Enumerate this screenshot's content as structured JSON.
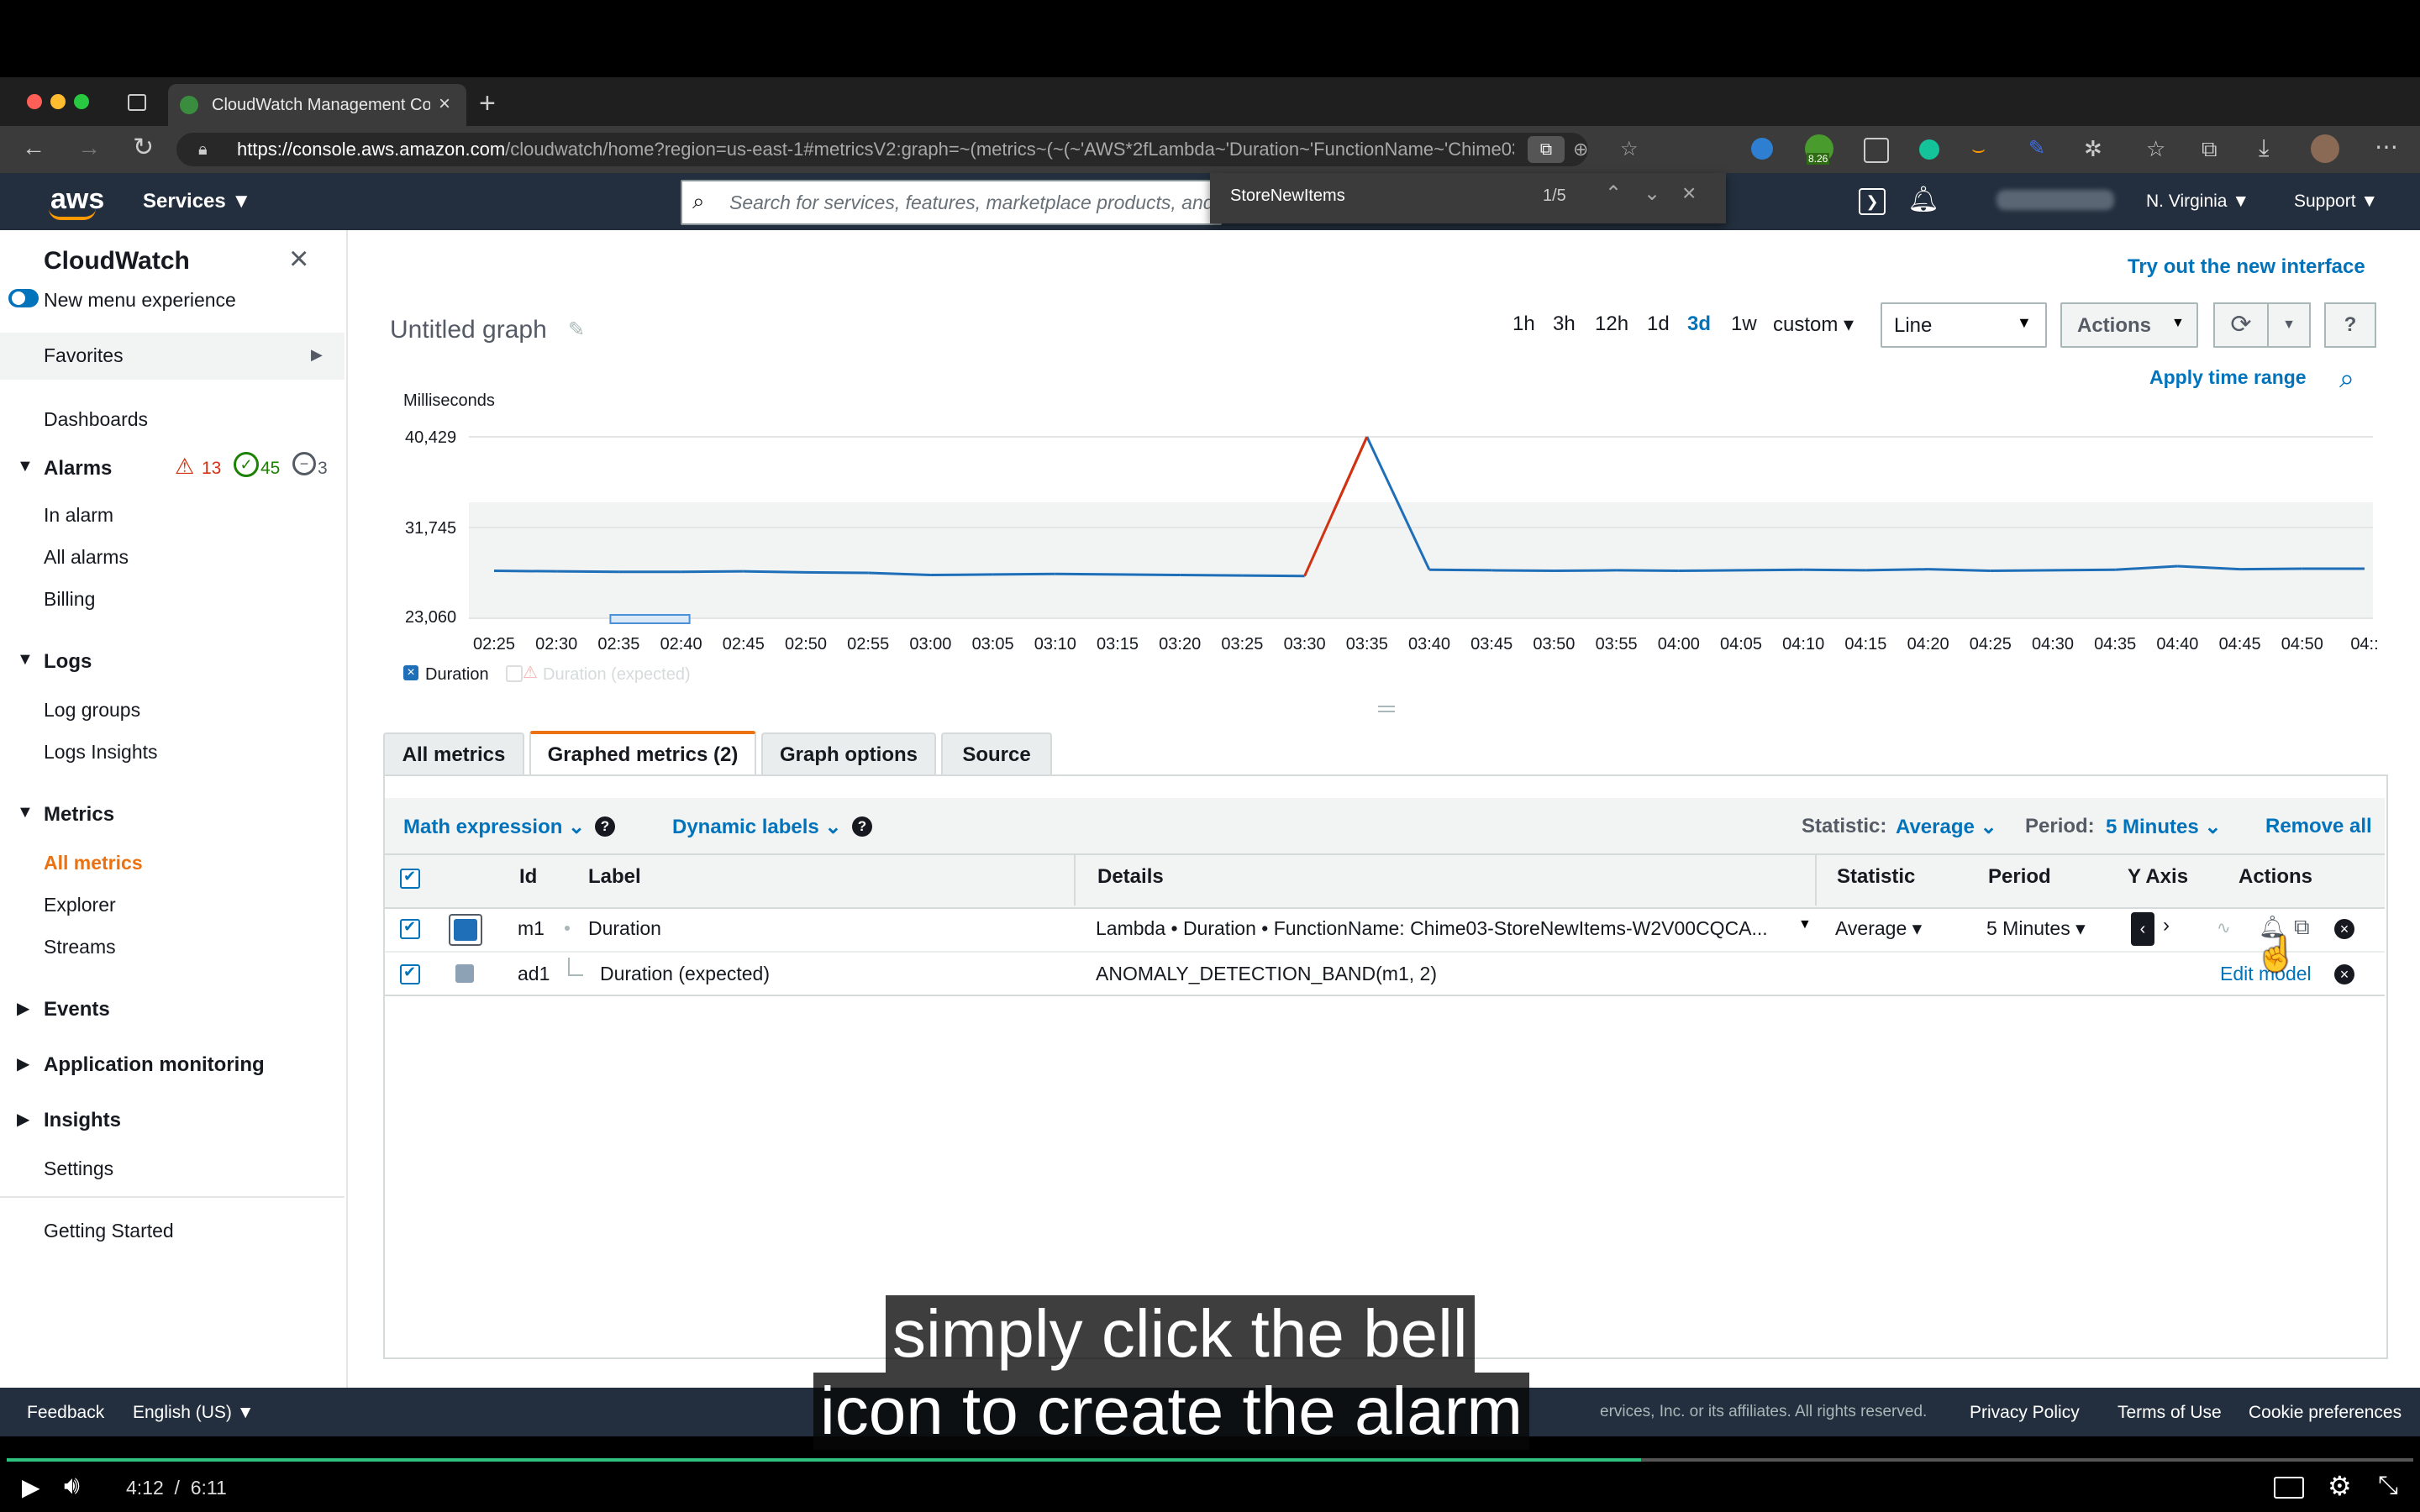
{
  "browser": {
    "tab_title": "CloudWatch Management Con",
    "url_host": "https://console.aws.amazon.com",
    "url_rest": "/cloudwatch/home?region=us-east-1#metricsV2:graph=~(metrics~(~(~'AWS*2fLambda~'Duration~'FunctionName~'Chime03-...",
    "find_query": "StoreNewItems",
    "find_count": "1/5",
    "ext_badge": "8.26"
  },
  "awsnav": {
    "logo": "aws",
    "services": "Services",
    "search_placeholder": "Search for services, features, marketplace products, and",
    "region": "N. Virginia",
    "support": "Support"
  },
  "sidebar": {
    "title": "CloudWatch",
    "new_menu": "New menu experience",
    "favorites": "Favorites",
    "dashboards": "Dashboards",
    "alarms": "Alarms",
    "alarm_count": "13",
    "ok_count": "45",
    "insufficient_count": "3",
    "in_alarm": "In alarm",
    "all_alarms": "All alarms",
    "billing": "Billing",
    "logs": "Logs",
    "log_groups": "Log groups",
    "logs_insights": "Logs Insights",
    "metrics": "Metrics",
    "all_metrics": "All metrics",
    "explorer": "Explorer",
    "streams": "Streams",
    "events": "Events",
    "app_monitoring": "Application monitoring",
    "insights": "Insights",
    "settings": "Settings",
    "getting_started": "Getting Started"
  },
  "graph": {
    "try_new": "Try out the new interface",
    "title": "Untitled graph",
    "ranges": [
      "1h",
      "3h",
      "12h",
      "1d",
      "3d",
      "1w",
      "custom"
    ],
    "active_range": "3d",
    "chart_type": "Line",
    "actions": "Actions",
    "apply_time_range": "Apply time range"
  },
  "chart_data": {
    "type": "line",
    "ylabel": "Milliseconds",
    "y_ticks": [
      "40,429",
      "31,745",
      "23,060"
    ],
    "ylim": [
      23060,
      40429
    ],
    "x": [
      "02:25",
      "02:30",
      "02:35",
      "02:40",
      "02:45",
      "02:50",
      "02:55",
      "03:00",
      "03:05",
      "03:10",
      "03:15",
      "03:20",
      "03:25",
      "03:30",
      "03:35",
      "03:40",
      "03:45",
      "03:50",
      "03:55",
      "04:00",
      "04:05",
      "04:10",
      "04:15",
      "04:20",
      "04:25",
      "04:30",
      "04:35",
      "04:40",
      "04:45",
      "04:50",
      "04::"
    ],
    "series": [
      {
        "name": "Duration",
        "values": [
          27600,
          27550,
          27500,
          27500,
          27550,
          27450,
          27400,
          27200,
          27250,
          27300,
          27250,
          27200,
          27150,
          27100,
          40429,
          27700,
          27650,
          27600,
          27650,
          27600,
          27650,
          27700,
          27650,
          27750,
          27600,
          27650,
          27700,
          28050,
          27750,
          27800,
          27800
        ]
      },
      {
        "name": "Duration (expected)",
        "values": []
      }
    ],
    "grid": true,
    "legend": "bottom-left"
  },
  "tabs": [
    "All metrics",
    "Graphed metrics (2)",
    "Graph options",
    "Source"
  ],
  "toolbar": {
    "math_expression": "Math expression",
    "dynamic_labels": "Dynamic labels",
    "statistic_label": "Statistic:",
    "statistic_value": "Average",
    "period_label": "Period:",
    "period_value": "5 Minutes",
    "remove_all": "Remove all"
  },
  "table": {
    "headers": [
      "Id",
      "Label",
      "Details",
      "Statistic",
      "Period",
      "Y Axis",
      "Actions"
    ],
    "rows": [
      {
        "id": "m1",
        "label": "Duration",
        "details": "Lambda • Duration • FunctionName: Chime03-StoreNewItems-W2V00CQCA...",
        "statistic": "Average",
        "period": "5 Minutes",
        "color": "#1f6fb8"
      },
      {
        "id": "ad1",
        "label": "Duration (expected)",
        "details": "ANOMALY_DETECTION_BAND(m1, 2)",
        "action": "Edit model",
        "color": "#8ea2b5"
      }
    ]
  },
  "footer": {
    "feedback": "Feedback",
    "language": "English (US)",
    "copyright": "ervices, Inc. or its affiliates. All rights reserved.",
    "privacy": "Privacy Policy",
    "terms": "Terms of Use",
    "cookies": "Cookie preferences"
  },
  "video": {
    "caption_line1": "simply click the bell",
    "caption_line2": "icon to create the alarm",
    "time": "4:12  /  6:11"
  }
}
